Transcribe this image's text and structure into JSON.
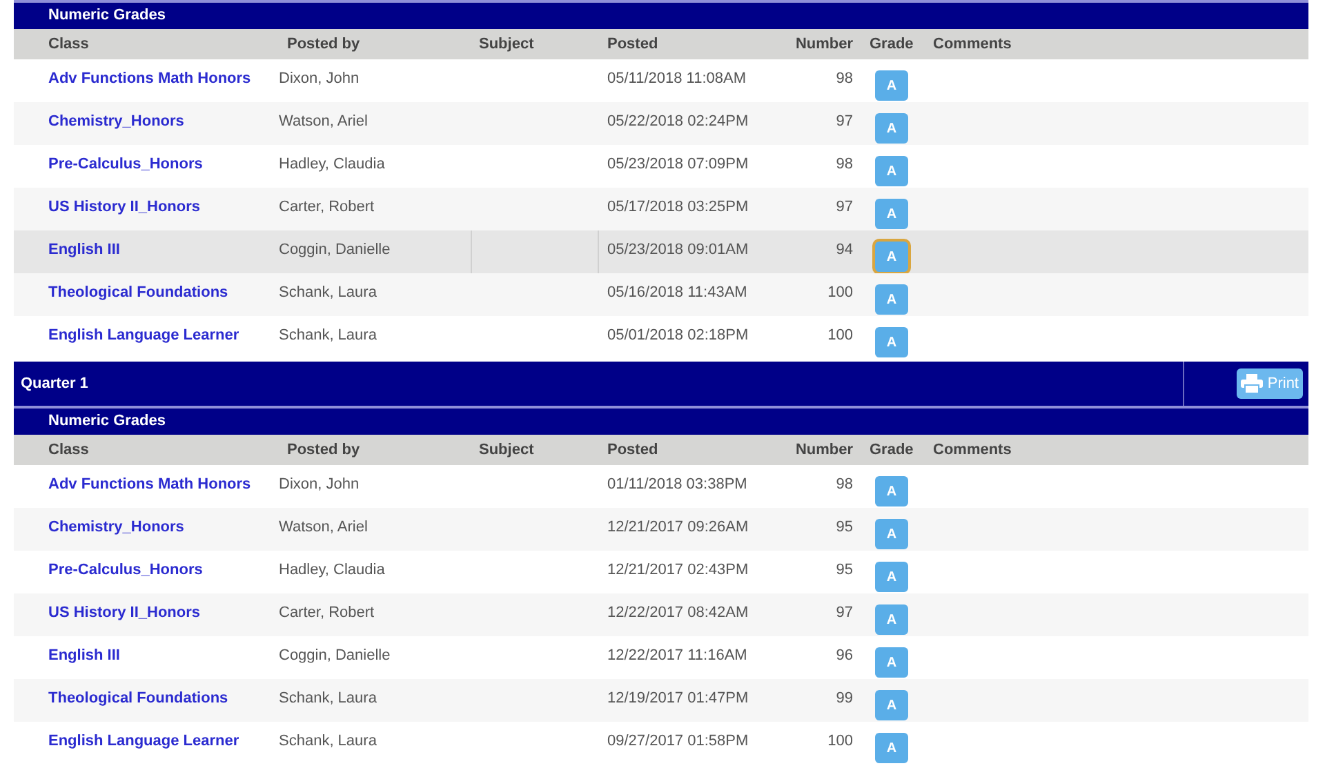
{
  "sections": [
    {
      "table": {
        "caption": "Numeric Grades",
        "columns": [
          "Class",
          "Posted by",
          "Subject",
          "Posted",
          "Number",
          "Grade",
          "Comments"
        ],
        "rows": [
          {
            "class": "Adv Functions Math Honors",
            "posted_by": "Dixon, John",
            "posted": "05/11/2018 11:08AM",
            "number": "98",
            "grade": "A",
            "selected": false
          },
          {
            "class": "Chemistry_Honors",
            "posted_by": "Watson, Ariel",
            "posted": "05/22/2018 02:24PM",
            "number": "97",
            "grade": "A",
            "selected": false
          },
          {
            "class": "Pre-Calculus_Honors",
            "posted_by": "Hadley, Claudia",
            "posted": "05/23/2018 07:09PM",
            "number": "98",
            "grade": "A",
            "selected": false
          },
          {
            "class": "US History II_Honors",
            "posted_by": "Carter, Robert",
            "posted": "05/17/2018 03:25PM",
            "number": "97",
            "grade": "A",
            "selected": false
          },
          {
            "class": "English III",
            "posted_by": "Coggin, Danielle",
            "posted": "05/23/2018 09:01AM",
            "number": "94",
            "grade": "A",
            "selected": true
          },
          {
            "class": "Theological Foundations",
            "posted_by": "Schank, Laura",
            "posted": "05/16/2018 11:43AM",
            "number": "100",
            "grade": "A",
            "selected": false
          },
          {
            "class": "English Language Learner",
            "posted_by": "Schank, Laura",
            "posted": "05/01/2018 02:18PM",
            "number": "100",
            "grade": "A",
            "selected": false
          }
        ]
      }
    },
    {
      "title": "Quarter 1",
      "print_button": "Print",
      "table": {
        "caption": "Numeric Grades",
        "columns": [
          "Class",
          "Posted by",
          "Subject",
          "Posted",
          "Number",
          "Grade",
          "Comments"
        ],
        "rows": [
          {
            "class": "Adv Functions Math Honors",
            "posted_by": "Dixon, John",
            "posted": "01/11/2018 03:38PM",
            "number": "98",
            "grade": "A",
            "selected": false
          },
          {
            "class": "Chemistry_Honors",
            "posted_by": "Watson, Ariel",
            "posted": "12/21/2017 09:26AM",
            "number": "95",
            "grade": "A",
            "selected": false
          },
          {
            "class": "Pre-Calculus_Honors",
            "posted_by": "Hadley, Claudia",
            "posted": "12/21/2017 02:43PM",
            "number": "95",
            "grade": "A",
            "selected": false
          },
          {
            "class": "US History II_Honors",
            "posted_by": "Carter, Robert",
            "posted": "12/22/2017 08:42AM",
            "number": "97",
            "grade": "A",
            "selected": false
          },
          {
            "class": "English III",
            "posted_by": "Coggin, Danielle",
            "posted": "12/22/2017 11:16AM",
            "number": "96",
            "grade": "A",
            "selected": false
          },
          {
            "class": "Theological Foundations",
            "posted_by": "Schank, Laura",
            "posted": "12/19/2017 01:47PM",
            "number": "99",
            "grade": "A",
            "selected": false
          },
          {
            "class": "English Language Learner",
            "posted_by": "Schank, Laura",
            "posted": "09/27/2017 01:58PM",
            "number": "100",
            "grade": "A",
            "selected": false
          }
        ]
      }
    }
  ]
}
